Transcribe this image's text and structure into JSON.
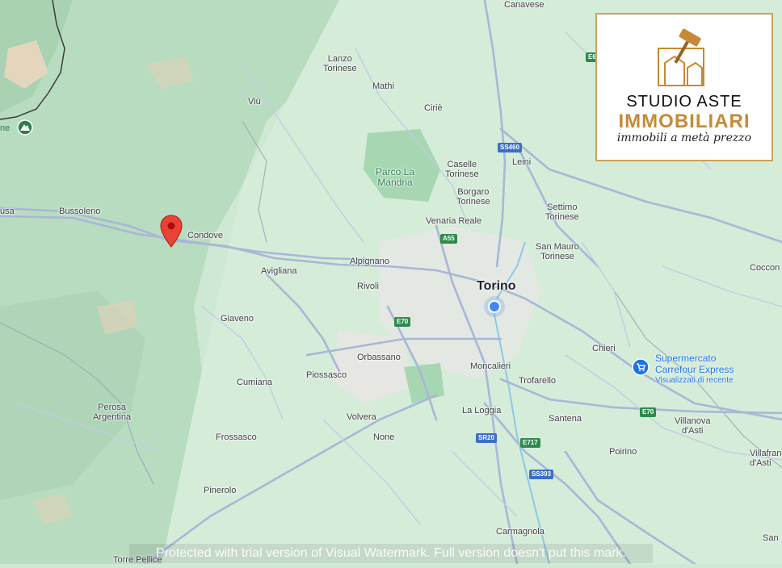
{
  "map": {
    "cities": [
      {
        "id": "torino",
        "name": "Torino"
      }
    ],
    "towns": [
      {
        "id": "canavese",
        "name": "Canavese"
      },
      {
        "id": "lanzo",
        "name": "Lanzo\nTorinese"
      },
      {
        "id": "mathi",
        "name": "Mathi"
      },
      {
        "id": "viu",
        "name": "Viù"
      },
      {
        "id": "cirie",
        "name": "Ciriè"
      },
      {
        "id": "leini",
        "name": "Leini"
      },
      {
        "id": "caselle",
        "name": "Caselle\nTorinese"
      },
      {
        "id": "borgaro",
        "name": "Borgaro\nTorinese"
      },
      {
        "id": "venaria",
        "name": "Venaria Reale"
      },
      {
        "id": "settimo",
        "name": "Settimo\nTorinese"
      },
      {
        "id": "sanmauro",
        "name": "San Mauro\nTorinese"
      },
      {
        "id": "bussoleno",
        "name": "Bussoleno"
      },
      {
        "id": "susa",
        "name": "usa"
      },
      {
        "id": "condove",
        "name": "Condove"
      },
      {
        "id": "avigliana",
        "name": "Avigliana"
      },
      {
        "id": "alpignano",
        "name": "Alpignano"
      },
      {
        "id": "rivoli",
        "name": "Rivoli"
      },
      {
        "id": "giaveno",
        "name": "Giaveno"
      },
      {
        "id": "orbassano",
        "name": "Orbassano"
      },
      {
        "id": "piossasco",
        "name": "Piossasco"
      },
      {
        "id": "cumiana",
        "name": "Cumiana"
      },
      {
        "id": "moncalieri",
        "name": "Moncalieri"
      },
      {
        "id": "trofarello",
        "name": "Trofarello"
      },
      {
        "id": "chieri",
        "name": "Chieri"
      },
      {
        "id": "perosa",
        "name": "Perosa\nArgentina"
      },
      {
        "id": "frossasco",
        "name": "Frossasco"
      },
      {
        "id": "volvera",
        "name": "Volvera"
      },
      {
        "id": "none",
        "name": "None"
      },
      {
        "id": "laloggia",
        "name": "La Loggia"
      },
      {
        "id": "santena",
        "name": "Santena"
      },
      {
        "id": "villanova",
        "name": "Villanova\nd'Asti"
      },
      {
        "id": "villafranca",
        "name": "Villafran\nd'Asti"
      },
      {
        "id": "poirino",
        "name": "Poirino"
      },
      {
        "id": "pinerolo",
        "name": "Pinerolo"
      },
      {
        "id": "carmagnola",
        "name": "Carmagnola"
      },
      {
        "id": "torrepellice",
        "name": "Torre Pellice"
      },
      {
        "id": "cocconato",
        "name": "Coccon"
      },
      {
        "id": "san",
        "name": "San"
      }
    ],
    "park": "Parco La\nMandria",
    "trail_label": "ne",
    "shields": [
      {
        "id": "ss460",
        "text": "SS460",
        "style": "blue"
      },
      {
        "id": "a55",
        "text": "A55",
        "style": "green"
      },
      {
        "id": "e70w",
        "text": "E70",
        "style": "green"
      },
      {
        "id": "e70e",
        "text": "E70",
        "style": "green"
      },
      {
        "id": "e6",
        "text": "E6",
        "style": "green"
      },
      {
        "id": "sr20",
        "text": "SR20",
        "style": "blue"
      },
      {
        "id": "e717",
        "text": "E717",
        "style": "green"
      },
      {
        "id": "ss393",
        "text": "SS393",
        "style": "blue"
      }
    ],
    "poi": {
      "name": "Supermercato\nCarrefour Express",
      "sub": "Visualizzati di recente",
      "icon": "shopping-cart-icon"
    },
    "pin_icon": "map-pin-icon",
    "my_location_icon": "location-dot-icon"
  },
  "logo": {
    "line1": "STUDIO ASTE",
    "line2": "IMMOBILIARI",
    "line3": "immobili a metà prezzo",
    "icon": "gavel-house-icon",
    "accent": "#c68a35"
  },
  "watermark": "Protected with trial version of Visual Watermark. Full version doesn't put this mark.",
  "colors": {
    "roads": "#a9b7d6",
    "pin": "#ea4335",
    "poi": "#1a73e8",
    "park": "#2e7d4f"
  }
}
